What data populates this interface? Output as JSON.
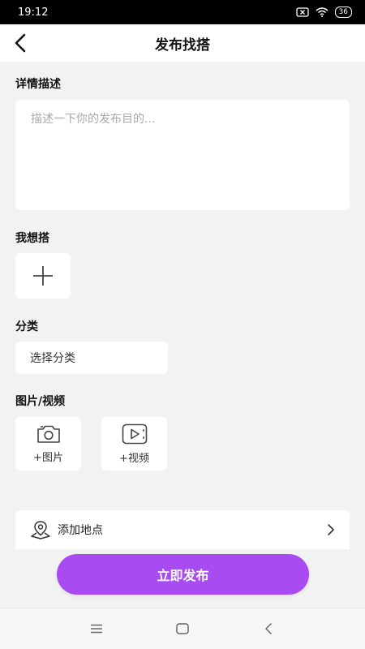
{
  "status_bar": {
    "time": "19:12",
    "battery": "36"
  },
  "header": {
    "title": "发布找搭"
  },
  "form": {
    "description": {
      "label": "详情描述",
      "placeholder": "描述一下你的发布目的...",
      "value": ""
    },
    "want": {
      "label": "我想搭"
    },
    "category": {
      "label": "分类",
      "placeholder": "选择分类"
    },
    "media": {
      "label": "图片/视频",
      "image_button": "+图片",
      "video_button": "+视频"
    },
    "location": {
      "label": "添加地点"
    }
  },
  "actions": {
    "publish_label": "立即发布"
  },
  "colors": {
    "accent": "#a84cf2",
    "background": "#f2f2f2"
  }
}
